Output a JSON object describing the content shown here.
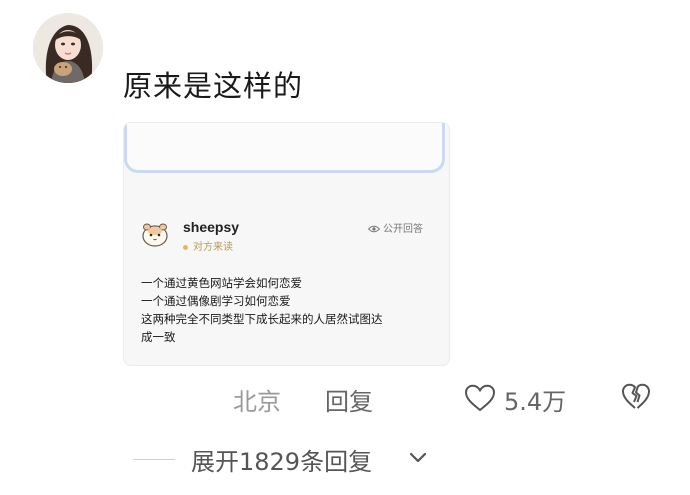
{
  "comment": {
    "text": "原来是这样的"
  },
  "card": {
    "username": "sheepsy",
    "status": "对方来读",
    "visibility": "公开回答",
    "lines": [
      "一个通过黄色网站学会如何恋爱",
      "一个通过偶像剧学习如何恋爱",
      "这两种完全不同类型下成长起来的人居然试图达",
      "成一致"
    ]
  },
  "meta": {
    "location": "北京",
    "reply_label": "回复",
    "like_count": "5.4万",
    "like_icon": "heart-outline-icon",
    "dislike_icon": "broken-heart-icon"
  },
  "expand": {
    "label": "展开1829条回复"
  },
  "colors": {
    "card_frame": "#c9daf1",
    "status_dot": "#e3b85a"
  }
}
